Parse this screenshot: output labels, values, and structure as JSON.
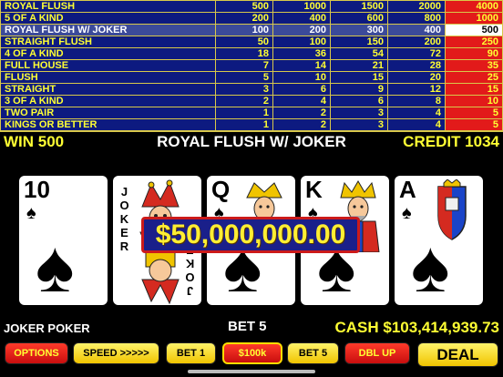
{
  "paytable": {
    "rows": [
      {
        "hand": "ROYAL FLUSH",
        "pays": [
          "500",
          "1000",
          "1500",
          "2000",
          "4000"
        ]
      },
      {
        "hand": "5 OF A KIND",
        "pays": [
          "200",
          "400",
          "600",
          "800",
          "1000"
        ]
      },
      {
        "hand": "ROYAL FLUSH W/ JOKER",
        "pays": [
          "100",
          "200",
          "300",
          "400",
          "500"
        ],
        "selected": true
      },
      {
        "hand": "STRAIGHT FLUSH",
        "pays": [
          "50",
          "100",
          "150",
          "200",
          "250"
        ]
      },
      {
        "hand": "4 OF A KIND",
        "pays": [
          "18",
          "36",
          "54",
          "72",
          "90"
        ]
      },
      {
        "hand": "FULL HOUSE",
        "pays": [
          "7",
          "14",
          "21",
          "28",
          "35"
        ]
      },
      {
        "hand": "FLUSH",
        "pays": [
          "5",
          "10",
          "15",
          "20",
          "25"
        ]
      },
      {
        "hand": "STRAIGHT",
        "pays": [
          "3",
          "6",
          "9",
          "12",
          "15"
        ]
      },
      {
        "hand": "3 OF A KIND",
        "pays": [
          "2",
          "4",
          "6",
          "8",
          "10"
        ]
      },
      {
        "hand": "TWO PAIR",
        "pays": [
          "1",
          "2",
          "3",
          "4",
          "5"
        ]
      },
      {
        "hand": "KINGS OR BETTER",
        "pays": [
          "1",
          "2",
          "3",
          "4",
          "5"
        ]
      }
    ],
    "highlight_column": 4
  },
  "status": {
    "win": "WIN 500",
    "hand_name": "ROYAL FLUSH W/ JOKER",
    "credit": "CREDIT 1034"
  },
  "cards": [
    {
      "rank": "10",
      "suit": "♠",
      "face": false
    },
    {
      "rank": "",
      "suit": "",
      "face": "joker",
      "label": "JOKER"
    },
    {
      "rank": "Q",
      "suit": "♠",
      "face": "queen"
    },
    {
      "rank": "K",
      "suit": "♠",
      "face": "king"
    },
    {
      "rank": "A",
      "suit": "♠",
      "face": "ace"
    }
  ],
  "jackpot": "$50,000,000.00",
  "footer": {
    "game_name": "JOKER POKER",
    "bet": "BET 5",
    "cash": "CASH $103,414,939.73"
  },
  "buttons": {
    "options": "OPTIONS",
    "speed": "SPEED >>>>>",
    "bet1": "BET 1",
    "denom": "$100k",
    "bet5": "BET 5",
    "dbl": "DBL UP",
    "deal": "DEAL"
  },
  "colors": {
    "paytable_bg": "#0d1a80",
    "paytable_text": "#ffff33",
    "highlight_col": "#e21a1a",
    "selected_row": "#3b4a9a",
    "button_red": "#e21a1a",
    "button_yellow": "#f8e030"
  }
}
